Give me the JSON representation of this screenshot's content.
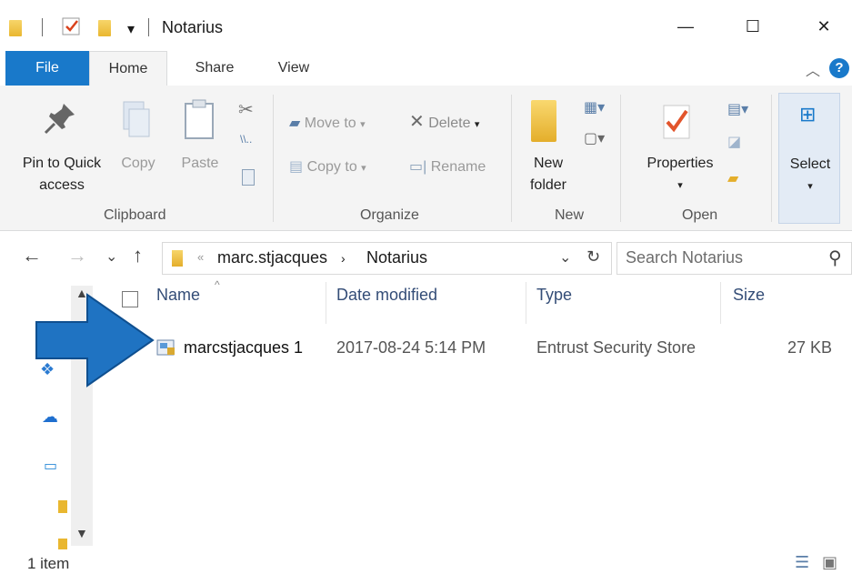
{
  "window": {
    "title": "Notarius",
    "minimize": "—",
    "maximize": "☐",
    "close": "✕"
  },
  "quick_access": {
    "dropdown": "▾"
  },
  "tabs": [
    {
      "label": "File"
    },
    {
      "label": "Home"
    },
    {
      "label": "Share"
    },
    {
      "label": "View"
    }
  ],
  "ribbon": {
    "clipboard": {
      "group_label": "Clipboard",
      "pin_line1": "Pin to Quick",
      "pin_line2": "access",
      "copy": "Copy",
      "paste": "Paste"
    },
    "organize": {
      "group_label": "Organize",
      "move_to": "Move to",
      "copy_to": "Copy to",
      "delete": "Delete",
      "rename": "Rename"
    },
    "new": {
      "group_label": "New",
      "new_folder_line1": "New",
      "new_folder_line2": "folder"
    },
    "open": {
      "group_label": "Open",
      "properties": "Properties"
    },
    "select": {
      "label": "Select"
    }
  },
  "address": {
    "path": [
      "marc.stjacques",
      "Notarius"
    ],
    "search_placeholder": "Search Notarius"
  },
  "columns": [
    "Name",
    "Date modified",
    "Type",
    "Size"
  ],
  "files": [
    {
      "name": "marcstjacques 1",
      "date_modified": "2017-08-24 5:14 PM",
      "type": "Entrust Security Store",
      "size": "27 KB"
    }
  ],
  "status": {
    "item_count": "1 item"
  },
  "colors": {
    "accent": "#1979ca",
    "arrow_overlay": "#1f73c2",
    "ribbon_bg": "#f4f4f4"
  }
}
